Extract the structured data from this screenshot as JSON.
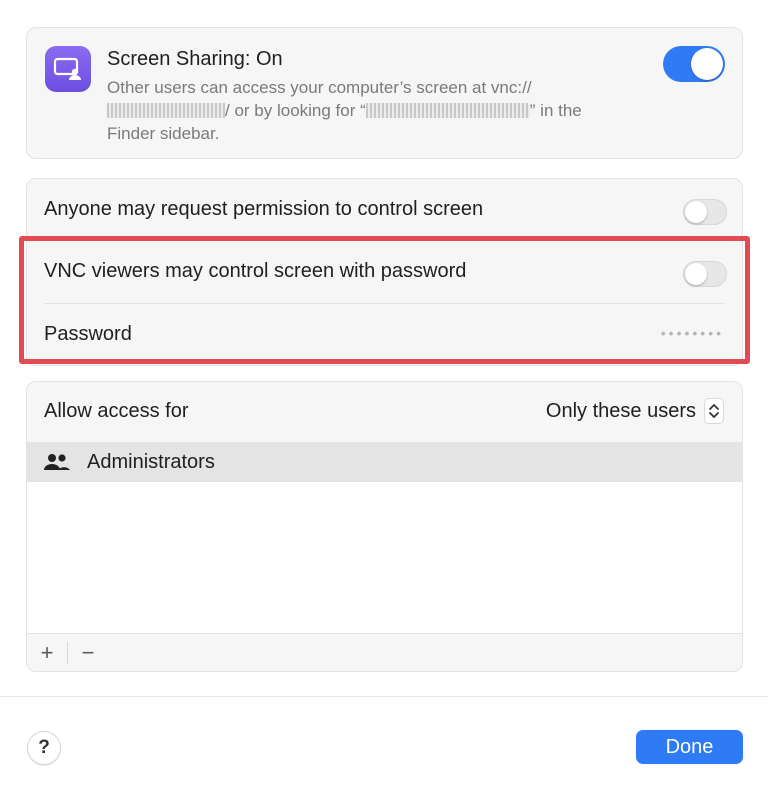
{
  "screen_sharing": {
    "title": "Screen Sharing: On",
    "description_part1": "Other users can access your computer’s screen at vnc://",
    "description_part2": "/ or by looking for “",
    "description_part3": "” in the",
    "description_part4": "Finder sidebar.",
    "enabled": true,
    "icon": "screen-sharing-icon"
  },
  "permissions": {
    "anyone_request_label": "Anyone may request permission to control screen",
    "anyone_request_enabled": false,
    "vnc_label": "VNC viewers may control screen with password",
    "vnc_enabled": false,
    "password_label": "Password",
    "password_value": "••••••••"
  },
  "access": {
    "label": "Allow access for",
    "selected_option": "Only these users",
    "users": [
      {
        "name": "Administrators",
        "icon": "group-icon"
      }
    ],
    "add_symbol": "+",
    "remove_symbol": "−"
  },
  "footer": {
    "help_label": "?",
    "done_label": "Done"
  },
  "colors": {
    "accent": "#2f7bf5",
    "highlight": "#e34b52",
    "app_icon": "#7a5ce8"
  }
}
